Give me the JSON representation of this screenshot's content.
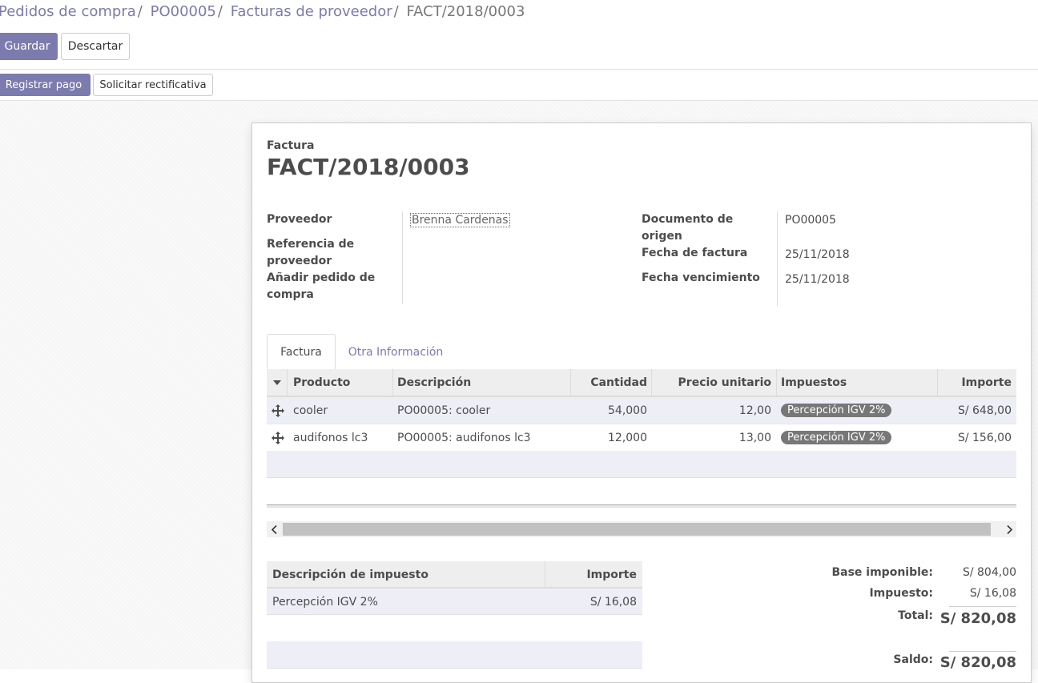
{
  "breadcrumb": [
    {
      "label": "Pedidos de compra"
    },
    {
      "label": "PO00005"
    },
    {
      "label": "Facturas de proveedor"
    },
    {
      "label": "FACT/2018/0003"
    }
  ],
  "breadcrumb_sep": "/",
  "toolbar": {
    "save_label": "Guardar",
    "discard_label": "Descartar"
  },
  "statusbar": {
    "register_payment_label": "Registrar pago",
    "refund_label": "Solicitar rectificativa"
  },
  "invoice": {
    "type_label": "Factura",
    "number": "FACT/2018/0003",
    "fields_left": [
      {
        "label": "Proveedor",
        "value": "Brenna Cardenas"
      },
      {
        "label": "Referencia de proveedor",
        "value": ""
      },
      {
        "label": "Añadir pedido de compra",
        "value": ""
      }
    ],
    "fields_right": [
      {
        "label": "Documento de origen",
        "value": "PO00005"
      },
      {
        "label": "Fecha de factura",
        "value": "25/11/2018"
      },
      {
        "label": "Fecha vencimiento",
        "value": "25/11/2018"
      }
    ]
  },
  "tabs": [
    {
      "label": "Factura"
    },
    {
      "label": "Otra Información"
    }
  ],
  "lines": {
    "headers": {
      "product": "Producto",
      "description": "Descripción",
      "quantity": "Cantidad",
      "unit_price": "Precio unitario",
      "taxes": "Impuestos",
      "amount": "Importe"
    },
    "rows": [
      {
        "product": "cooler",
        "description": "PO00005: cooler",
        "quantity": "54,000",
        "unit_price": "12,00",
        "tax": "Percepción IGV 2%",
        "amount": "S/ 648,00"
      },
      {
        "product": "audifonos lc3",
        "description": "PO00005: audifonos lc3",
        "quantity": "12,000",
        "unit_price": "13,00",
        "tax": "Percepción IGV 2%",
        "amount": "S/ 156,00"
      }
    ]
  },
  "tax_table": {
    "headers": {
      "description": "Descripción de impuesto",
      "amount": "Importe"
    },
    "rows": [
      {
        "description": "Percepción IGV 2%",
        "amount": "S/ 16,08"
      }
    ]
  },
  "totals": {
    "base_label": "Base imponible:",
    "base_value": "S/ 804,00",
    "tax_label": "Impuesto:",
    "tax_value": "S/ 16,08",
    "total_label": "Total:",
    "total_value": "S/ 820,08",
    "balance_label": "Saldo:",
    "balance_value": "S/ 820,08"
  },
  "colors": {
    "brand": "#7c7bad",
    "badge": "#777777",
    "row_alt": "#eeeef6"
  },
  "icons": {
    "sort": "caret-down-icon",
    "drag": "move-handle-icon",
    "scroll_left": "chevron-left-icon",
    "scroll_right": "chevron-right-icon"
  }
}
